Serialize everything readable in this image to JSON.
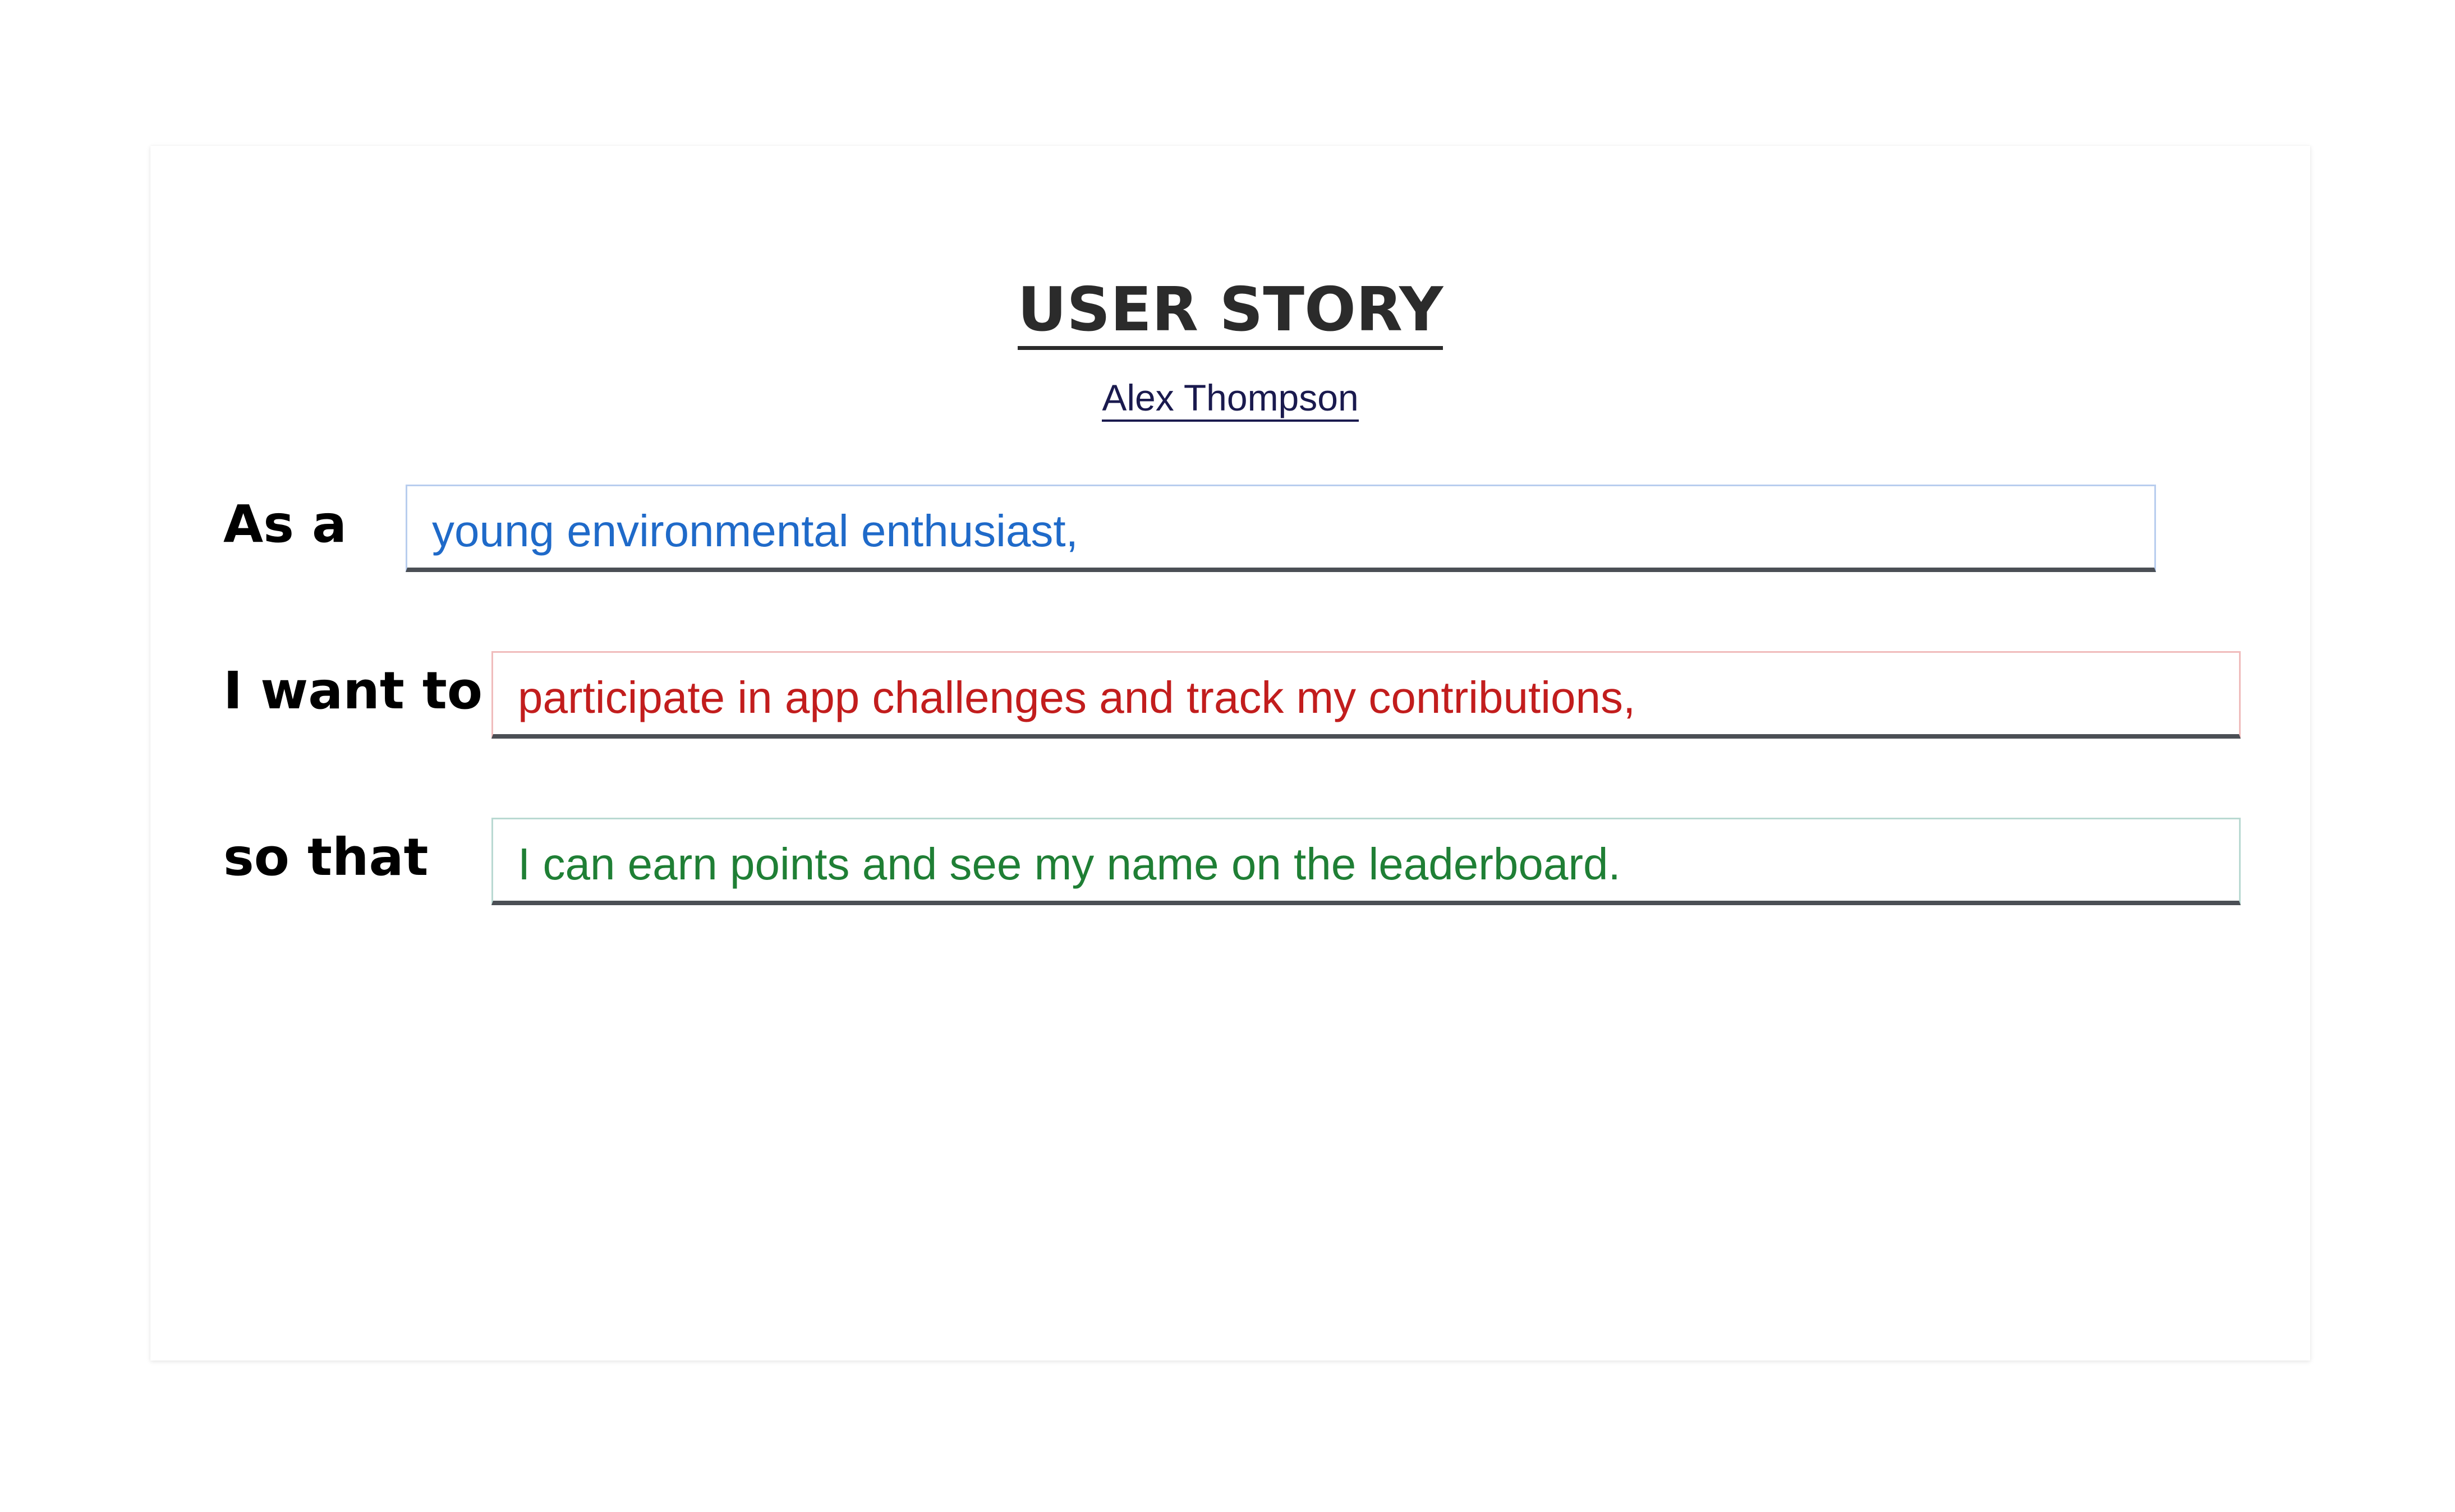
{
  "story": {
    "title": "USER STORY",
    "author": "Alex Thompson",
    "rows": [
      {
        "label": "As a",
        "value": "young environmental enthusiast,",
        "color": "#1f6ac9"
      },
      {
        "label": "I want to",
        "value": "participate in app challenges and track my contributions,",
        "color": "#c21d1d"
      },
      {
        "label": "so that",
        "value": "I can earn points and see my name on the leaderboard.",
        "color": "#1f7f35"
      }
    ]
  }
}
